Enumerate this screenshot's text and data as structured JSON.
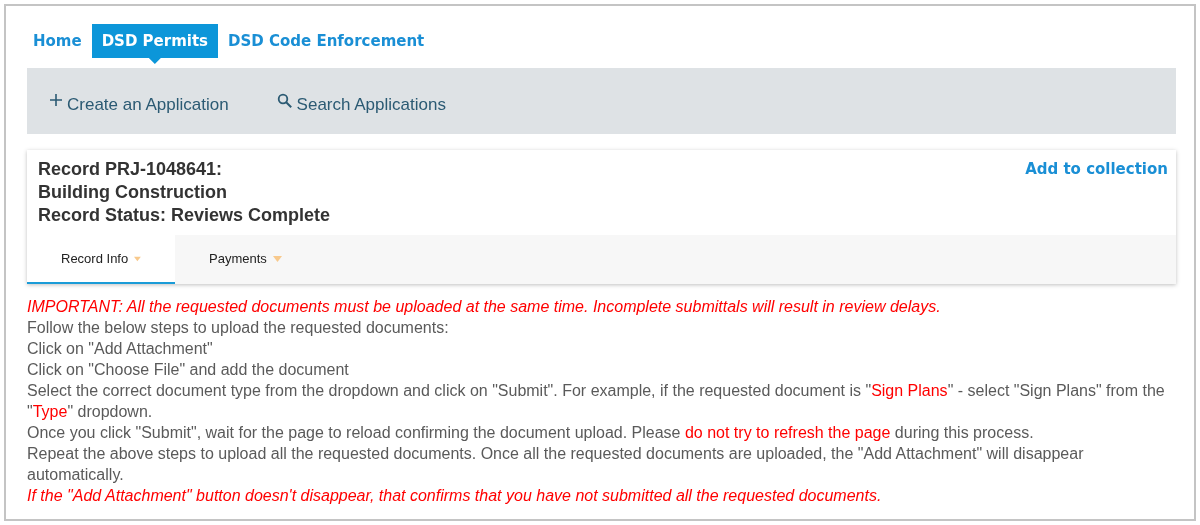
{
  "nav_tabs": [
    {
      "label": "Home",
      "selected": false
    },
    {
      "label": "DSD Permits",
      "selected": true
    },
    {
      "label": "DSD Code Enforcement",
      "selected": false
    }
  ],
  "toolbar": [
    {
      "label": "Create an Application",
      "kind": "create"
    },
    {
      "label": "Search Applications",
      "kind": "search"
    }
  ],
  "record": {
    "title_lines": [
      "Record PRJ-1048641:",
      "Building Construction",
      "Record Status: Reviews Complete"
    ],
    "add_link": "Add to collection"
  },
  "record_tabs": [
    {
      "label": "Record Info",
      "selected": true
    },
    {
      "label": "Payments",
      "selected": false
    }
  ],
  "instructions": [
    {
      "kind": "warning",
      "text": "IMPORTANT: All the requested documents must be uploaded at the same time.  Incomplete submittals will result in review delays."
    },
    {
      "kind": "text",
      "text": "Follow the below steps to upload the requested documents:"
    },
    {
      "kind": "text",
      "text": "Click on \"Add Attachment\""
    },
    {
      "kind": "text",
      "text": "Click on \"Choose File\" and add the document"
    },
    {
      "kind": "text",
      "segments": [
        {
          "text": "Select the correct document type from the dropdown and click on \"Submit\".  For example, if the requested document is \"",
          "highlight": false
        },
        {
          "text": "Sign Plans",
          "highlight": true
        },
        {
          "text": "\" - select \"Sign Plans\" from the \"",
          "highlight": false
        },
        {
          "text": "Type",
          "highlight": true
        },
        {
          "text": "\" dropdown.",
          "highlight": false
        }
      ]
    },
    {
      "kind": "text",
      "segments": [
        {
          "text": "Once you click \"Submit\", wait for the page to reload confirming the document upload.  Please ",
          "highlight": false
        },
        {
          "text": "do not try to refresh the page",
          "highlight": true
        },
        {
          "text": " during this process.",
          "highlight": false
        }
      ]
    },
    {
      "kind": "text",
      "text": "Repeat the above steps to upload all the requested documents.  Once all the requested documents are uploaded, the \"Add Attachment\" will disappear automatically."
    },
    {
      "kind": "warning",
      "text": "If the \"Add Attachment\" button doesn't disappear, that confirms that you have not submitted all the requested documents."
    }
  ]
}
